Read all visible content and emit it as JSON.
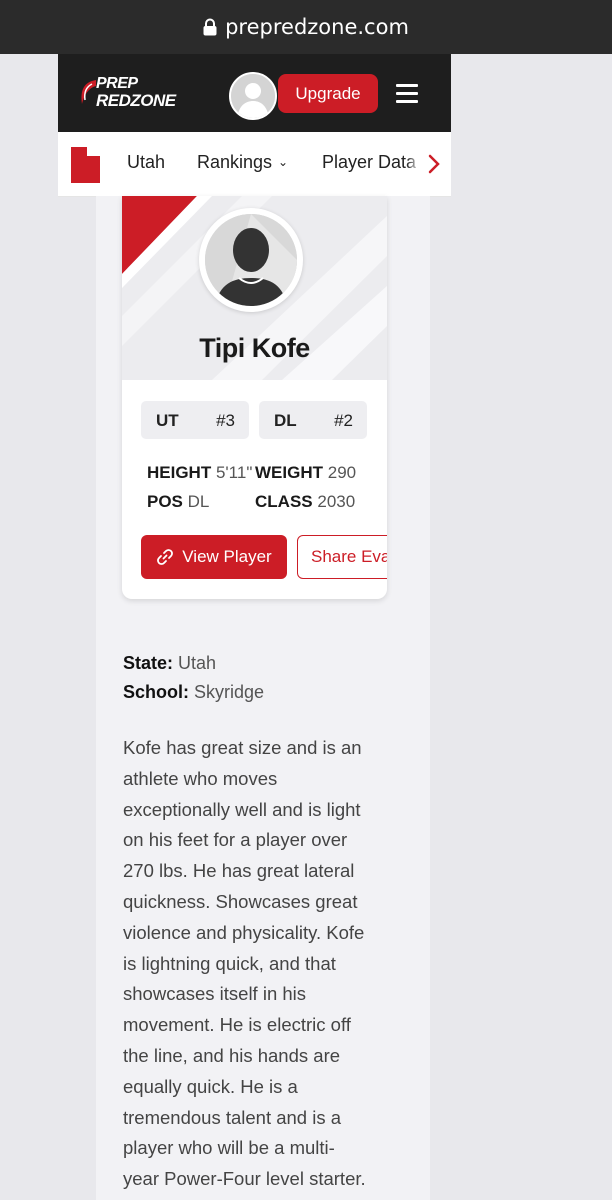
{
  "browser": {
    "url": "prepredzone.com"
  },
  "header": {
    "logo_line1": "PREP",
    "logo_line2": "REDZONE",
    "upgrade_label": "Upgrade"
  },
  "subnav": {
    "items": [
      "Utah",
      "Rankings",
      "Player Data"
    ]
  },
  "player": {
    "name": "Tipi Kofe",
    "state_rank": {
      "label": "UT",
      "value": "#3"
    },
    "position_rank": {
      "label": "DL",
      "value": "#2"
    },
    "stats": {
      "height_label": "HEIGHT",
      "height": "5'11\"",
      "weight_label": "WEIGHT",
      "weight": "290",
      "pos_label": "POS",
      "pos": "DL",
      "class_label": "CLASS",
      "class": "2030"
    },
    "view_label": "View Player",
    "share_label": "Share Evaluation"
  },
  "details": {
    "state_label": "State:",
    "state": "Utah",
    "school_label": "School:",
    "school": "Skyridge"
  },
  "bio_lines": [
    "Kofe has great size and is an",
    "athlete who moves",
    "exceptionally well and is light",
    "on his feet for a player over",
    "270 lbs. He has great lateral",
    "quickness. Showcases great",
    "violence and physicality. Kofe",
    "is lightning quick, and that",
    "showcases itself in his",
    "movement. He is electric off",
    "the line, and his hands are",
    "equally quick. He is a",
    "tremendous talent and is a",
    "player who will be a multi-",
    "year Power-Four level starter."
  ],
  "colors": {
    "brand_red": "#cc1d26",
    "header_dark": "#1e1e1e"
  },
  "icons": [
    "lock-icon",
    "avatar-icon",
    "hamburger-icon",
    "utah-state-icon",
    "chevron-down-icon",
    "chevron-right-icon",
    "link-icon"
  ]
}
